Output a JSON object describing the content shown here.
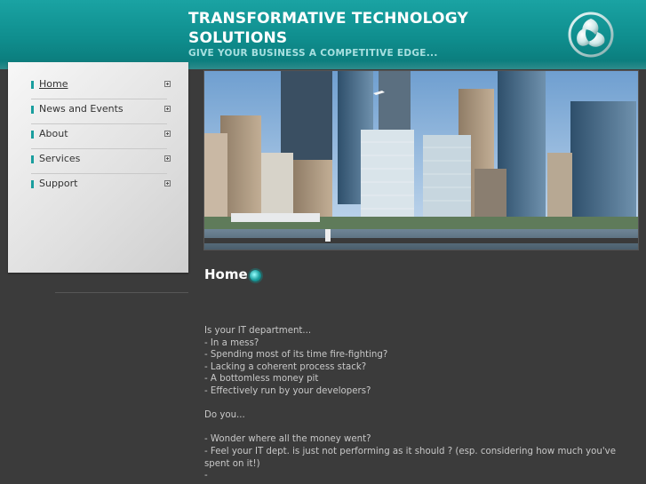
{
  "header": {
    "title": "TRANSFORMATIVE TECHNOLOGY SOLUTIONS",
    "tagline": "GIVE YOUR BUSINESS A COMPETITIVE EDGE...",
    "logo_icon": "triskele-ring-logo-icon"
  },
  "nav": {
    "items": [
      {
        "label": "Home",
        "active": true
      },
      {
        "label": "News and Events",
        "active": false
      },
      {
        "label": "About",
        "active": false
      },
      {
        "label": "Services",
        "active": false
      },
      {
        "label": "Support",
        "active": false
      }
    ]
  },
  "content": {
    "title": "Home",
    "lines": [
      "Is your IT department...",
      "- In a mess?",
      "- Spending most of its time fire-fighting?",
      "- Lacking a coherent process stack?",
      "- A bottomless money pit",
      "- Effectively run by your developers?",
      "",
      "Do you...",
      "",
      "- Wonder where all the money went?",
      "- Feel your IT dept. is just not performing as it should ? (esp. considering how much you've spent on it!)",
      "-"
    ]
  },
  "colors": {
    "header_teal": "#1aa3a3",
    "accent": "#1a9e9e",
    "background": "#3b3b3b",
    "body_text": "#c8c8c8"
  }
}
